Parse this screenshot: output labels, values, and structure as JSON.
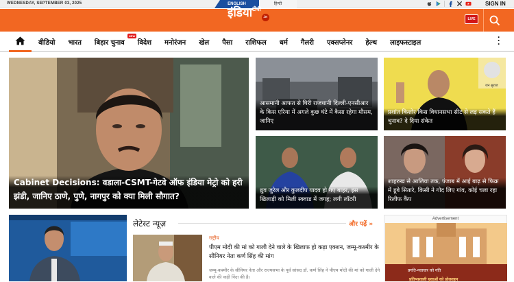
{
  "topbar": {
    "date": "WEDNESDAY, SEPTEMBER 03, 2025",
    "lang_english": "ENGLISH",
    "lang_hindi": "हिन्दी",
    "signin": "SIGN IN",
    "icons": [
      "apple-icon",
      "google-play-icon",
      "facebook-icon",
      "x-icon",
      "youtube-icon"
    ]
  },
  "header": {
    "logo_main": "इंडिया",
    "logo_tv": "टीवी",
    "logo_in": ".in",
    "live_label": "LIVE",
    "brand_color": "#f26722"
  },
  "nav": {
    "items": [
      "वीडियो",
      "भारत",
      "बिहार चुनाव",
      "विदेश",
      "मनोरंजन",
      "खेल",
      "पैसा",
      "राशिफल",
      "धर्म",
      "गैलरी",
      "एक्सप्लेनर",
      "हेल्थ",
      "लाइफस्टाइल"
    ],
    "new_badge": "NEW"
  },
  "lead": {
    "caption": "Cabinet Decisions: वडाला-CSMT-गेटवे ऑफ इंडिया मेट्रो को हरी झंडी, जानिए ठाणे, पुणे, नागपुर को क्या मिली सौगात?"
  },
  "stories": [
    {
      "caption": "आसमानी आफत से घिरी राजधानी दिल्ली-एनसीआर के किस एरिया में अगले कुछ घंटे में कैसा रहेगा मौसम, जानिए"
    },
    {
      "caption": "प्रशांत किशोर किस विधानसभा सीट से लड़ सकते हैं चुनाव? दे दिया संकेत"
    },
    {
      "caption": "ध्रुव जुरेल और कुलदीप यादव हो गए बाहर, इस खिलाड़ी को मिली स्क्वाड में जगह; लगी लॉटरी"
    },
    {
      "caption": "शाहरुख से आलिया तक, पंजाब में आई बाढ़ से फिक्र में डूबे सितारे, किसी ने गोद लिए गांव, कोई चला रहा रिलीफ कैंप"
    }
  ],
  "thumb_text": "जन सुराज",
  "latest": {
    "title": "लेटेस्ट न्यूज़",
    "more": "और पढ़ें »",
    "category": "राष्ट्रीय",
    "headline": "पीएम मोदी की मां को गाली देने वाले के खिलाफ हो कड़ा एक्शन, जम्मू-कश्मीर के सीनियर नेता कर्ण सिंह की मांग",
    "summary": "जम्मू-कश्मीर के सीनियर नेता और राज्यसभा के पूर्व सांसद डॉ. कर्ण सिंह ने पीएम मोदी की मां को गाली देने वाले की कड़ी निंदा की है।"
  },
  "ad": {
    "label": "Advertisement",
    "text1": "प्रगति-नवाचार को गति",
    "text2": "प्रतिभाशाली युवाओं को प्रोत्साहन"
  }
}
